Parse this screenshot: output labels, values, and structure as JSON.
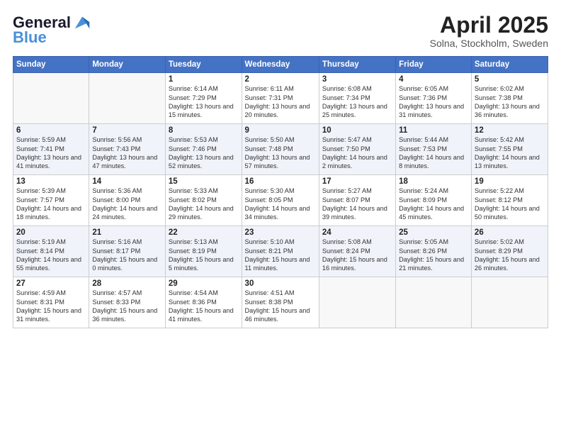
{
  "header": {
    "logo_line1": "General",
    "logo_line2": "Blue",
    "month_title": "April 2025",
    "location": "Solna, Stockholm, Sweden"
  },
  "days_of_week": [
    "Sunday",
    "Monday",
    "Tuesday",
    "Wednesday",
    "Thursday",
    "Friday",
    "Saturday"
  ],
  "weeks": [
    [
      {
        "day": "",
        "info": ""
      },
      {
        "day": "",
        "info": ""
      },
      {
        "day": "1",
        "info": "Sunrise: 6:14 AM\nSunset: 7:29 PM\nDaylight: 13 hours and 15 minutes."
      },
      {
        "day": "2",
        "info": "Sunrise: 6:11 AM\nSunset: 7:31 PM\nDaylight: 13 hours and 20 minutes."
      },
      {
        "day": "3",
        "info": "Sunrise: 6:08 AM\nSunset: 7:34 PM\nDaylight: 13 hours and 25 minutes."
      },
      {
        "day": "4",
        "info": "Sunrise: 6:05 AM\nSunset: 7:36 PM\nDaylight: 13 hours and 31 minutes."
      },
      {
        "day": "5",
        "info": "Sunrise: 6:02 AM\nSunset: 7:38 PM\nDaylight: 13 hours and 36 minutes."
      }
    ],
    [
      {
        "day": "6",
        "info": "Sunrise: 5:59 AM\nSunset: 7:41 PM\nDaylight: 13 hours and 41 minutes."
      },
      {
        "day": "7",
        "info": "Sunrise: 5:56 AM\nSunset: 7:43 PM\nDaylight: 13 hours and 47 minutes."
      },
      {
        "day": "8",
        "info": "Sunrise: 5:53 AM\nSunset: 7:46 PM\nDaylight: 13 hours and 52 minutes."
      },
      {
        "day": "9",
        "info": "Sunrise: 5:50 AM\nSunset: 7:48 PM\nDaylight: 13 hours and 57 minutes."
      },
      {
        "day": "10",
        "info": "Sunrise: 5:47 AM\nSunset: 7:50 PM\nDaylight: 14 hours and 2 minutes."
      },
      {
        "day": "11",
        "info": "Sunrise: 5:44 AM\nSunset: 7:53 PM\nDaylight: 14 hours and 8 minutes."
      },
      {
        "day": "12",
        "info": "Sunrise: 5:42 AM\nSunset: 7:55 PM\nDaylight: 14 hours and 13 minutes."
      }
    ],
    [
      {
        "day": "13",
        "info": "Sunrise: 5:39 AM\nSunset: 7:57 PM\nDaylight: 14 hours and 18 minutes."
      },
      {
        "day": "14",
        "info": "Sunrise: 5:36 AM\nSunset: 8:00 PM\nDaylight: 14 hours and 24 minutes."
      },
      {
        "day": "15",
        "info": "Sunrise: 5:33 AM\nSunset: 8:02 PM\nDaylight: 14 hours and 29 minutes."
      },
      {
        "day": "16",
        "info": "Sunrise: 5:30 AM\nSunset: 8:05 PM\nDaylight: 14 hours and 34 minutes."
      },
      {
        "day": "17",
        "info": "Sunrise: 5:27 AM\nSunset: 8:07 PM\nDaylight: 14 hours and 39 minutes."
      },
      {
        "day": "18",
        "info": "Sunrise: 5:24 AM\nSunset: 8:09 PM\nDaylight: 14 hours and 45 minutes."
      },
      {
        "day": "19",
        "info": "Sunrise: 5:22 AM\nSunset: 8:12 PM\nDaylight: 14 hours and 50 minutes."
      }
    ],
    [
      {
        "day": "20",
        "info": "Sunrise: 5:19 AM\nSunset: 8:14 PM\nDaylight: 14 hours and 55 minutes."
      },
      {
        "day": "21",
        "info": "Sunrise: 5:16 AM\nSunset: 8:17 PM\nDaylight: 15 hours and 0 minutes."
      },
      {
        "day": "22",
        "info": "Sunrise: 5:13 AM\nSunset: 8:19 PM\nDaylight: 15 hours and 5 minutes."
      },
      {
        "day": "23",
        "info": "Sunrise: 5:10 AM\nSunset: 8:21 PM\nDaylight: 15 hours and 11 minutes."
      },
      {
        "day": "24",
        "info": "Sunrise: 5:08 AM\nSunset: 8:24 PM\nDaylight: 15 hours and 16 minutes."
      },
      {
        "day": "25",
        "info": "Sunrise: 5:05 AM\nSunset: 8:26 PM\nDaylight: 15 hours and 21 minutes."
      },
      {
        "day": "26",
        "info": "Sunrise: 5:02 AM\nSunset: 8:29 PM\nDaylight: 15 hours and 26 minutes."
      }
    ],
    [
      {
        "day": "27",
        "info": "Sunrise: 4:59 AM\nSunset: 8:31 PM\nDaylight: 15 hours and 31 minutes."
      },
      {
        "day": "28",
        "info": "Sunrise: 4:57 AM\nSunset: 8:33 PM\nDaylight: 15 hours and 36 minutes."
      },
      {
        "day": "29",
        "info": "Sunrise: 4:54 AM\nSunset: 8:36 PM\nDaylight: 15 hours and 41 minutes."
      },
      {
        "day": "30",
        "info": "Sunrise: 4:51 AM\nSunset: 8:38 PM\nDaylight: 15 hours and 46 minutes."
      },
      {
        "day": "",
        "info": ""
      },
      {
        "day": "",
        "info": ""
      },
      {
        "day": "",
        "info": ""
      }
    ]
  ]
}
